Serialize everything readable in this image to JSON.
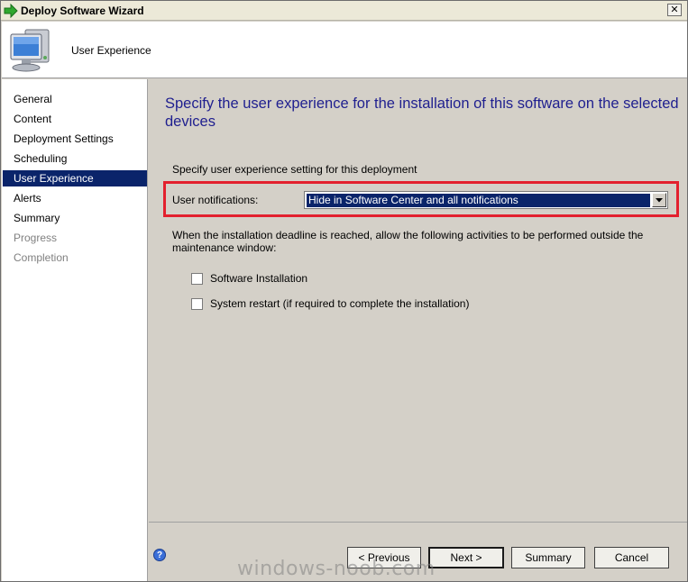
{
  "window": {
    "title": "Deploy Software Wizard",
    "close_glyph": "✕"
  },
  "header": {
    "title": "User Experience",
    "icon": "computer-monitor-icon"
  },
  "nav": {
    "items": [
      {
        "label": "General",
        "state": "normal"
      },
      {
        "label": "Content",
        "state": "normal"
      },
      {
        "label": "Deployment Settings",
        "state": "normal"
      },
      {
        "label": "Scheduling",
        "state": "normal"
      },
      {
        "label": "User Experience",
        "state": "selected"
      },
      {
        "label": "Alerts",
        "state": "normal"
      },
      {
        "label": "Summary",
        "state": "normal"
      },
      {
        "label": "Progress",
        "state": "disabled"
      },
      {
        "label": "Completion",
        "state": "disabled"
      }
    ]
  },
  "main": {
    "heading": "Specify the user experience for the installation of this software on the selected devices",
    "subtext": "Specify user experience setting for this deployment",
    "notifications_label": "User notifications:",
    "notifications_value": "Hide in Software Center and all notifications",
    "deadline_text": "When the installation deadline is reached, allow the following activities to be performed outside the maintenance window:",
    "checkboxes": [
      {
        "label": "Software Installation",
        "checked": false
      },
      {
        "label": "System restart  (if required to complete the installation)",
        "checked": false
      }
    ]
  },
  "footer": {
    "help_glyph": "?",
    "previous_label": "< Previous",
    "next_label": "Next >",
    "summary_label": "Summary",
    "cancel_label": "Cancel"
  },
  "watermark": "windows-noob.com",
  "colors": {
    "selection": "#0a246a",
    "heading": "#1f1f8f",
    "highlight": "#e3202e",
    "background": "#d4d0c8"
  }
}
